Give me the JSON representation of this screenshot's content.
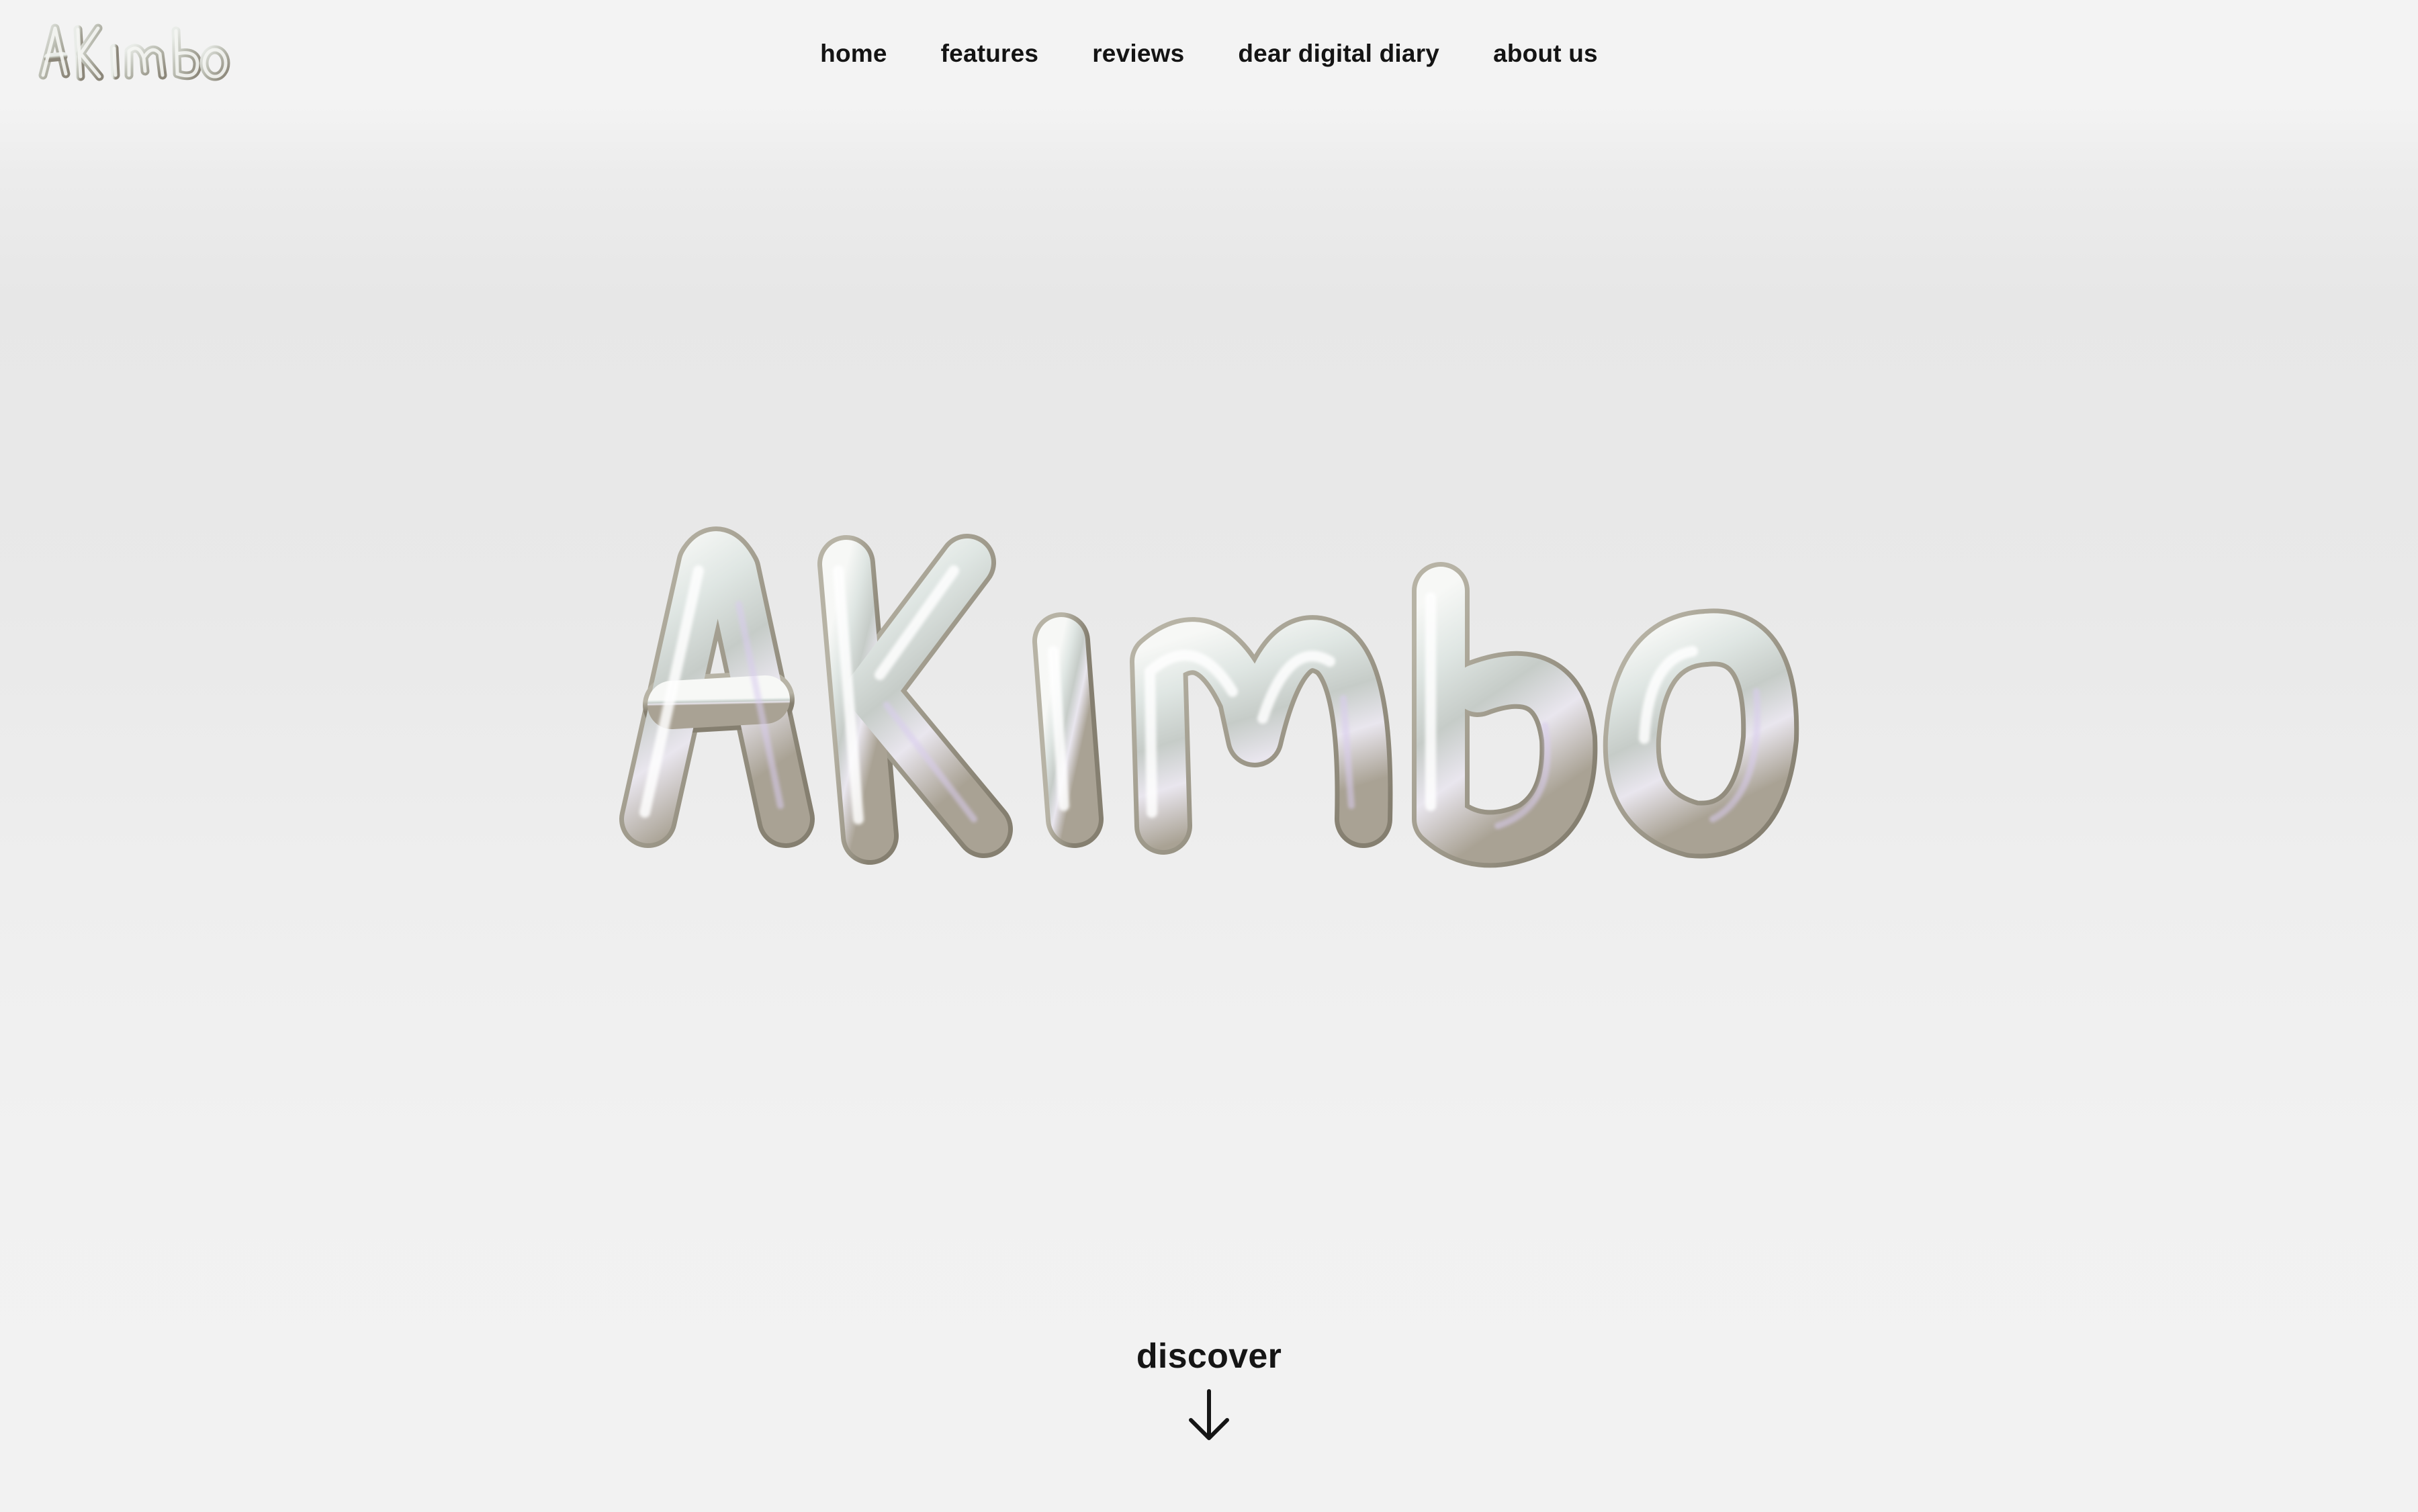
{
  "header": {
    "logo_text": "AKimbo",
    "logo_icon": "akimbo-logo-icon",
    "nav_items": [
      {
        "label": "home"
      },
      {
        "label": "features"
      },
      {
        "label": "reviews"
      },
      {
        "label": "dear digital diary"
      },
      {
        "label": "about us"
      }
    ]
  },
  "hero": {
    "wordmark_text": "AKimbo",
    "wordmark_icon": "akimbo-chrome-wordmark"
  },
  "discover": {
    "label": "discover",
    "icon": "arrow-down-icon"
  },
  "colors": {
    "background": "#f2f2f2",
    "text": "#1a1a1a",
    "chrome_light": "#ffffff",
    "chrome_mid": "#cfd6d4",
    "chrome_dark": "#8f8a7e"
  }
}
